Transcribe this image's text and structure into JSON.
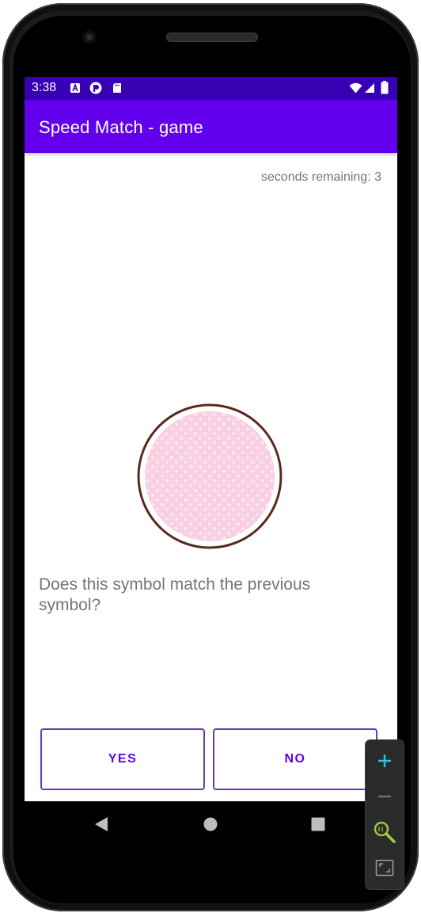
{
  "status_bar": {
    "time": "3:38",
    "left_icons": [
      "a-notification-icon",
      "play-circle-icon",
      "sd-card-icon"
    ],
    "right_icons": [
      "wifi-icon",
      "signal-icon",
      "battery-icon"
    ]
  },
  "app_bar": {
    "title": "Speed Match - game"
  },
  "game": {
    "timer_text": "seconds remaining: 3",
    "symbol_icon": "pink-polka-dot-circle",
    "question": "Does this symbol match the previous symbol?"
  },
  "buttons": {
    "yes_label": "YES",
    "no_label": "NO"
  },
  "nav_bar": {
    "icons": [
      "back-icon",
      "home-icon",
      "recents-icon"
    ]
  },
  "emulator_zoom": {
    "icons": [
      "zoom-in-icon",
      "zoom-out-icon",
      "zoom-actual-size-icon",
      "zoom-fit-icon"
    ]
  },
  "colors": {
    "status_bar": "#3700b3",
    "app_bar": "#6200ee",
    "button_border": "#673ab7",
    "button_text": "#6200ee",
    "secondary_text": "#757575",
    "symbol_fill": "#f9cfe2",
    "symbol_ring": "#5a2a22"
  }
}
